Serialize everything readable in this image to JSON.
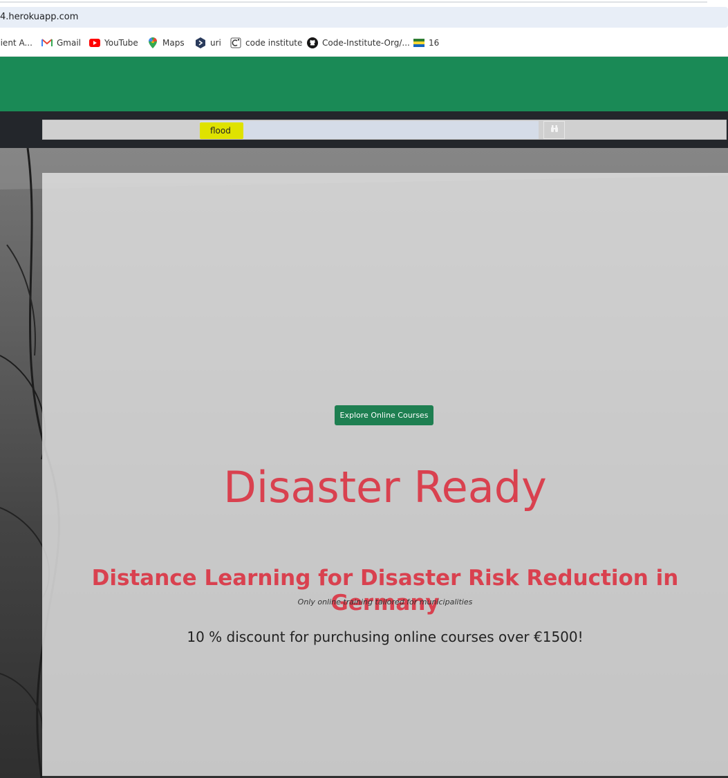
{
  "browser": {
    "url": "4.herokuapp.com",
    "bookmarks": [
      {
        "label": "cient A...",
        "icon": "bookmark-icon"
      },
      {
        "label": "Gmail",
        "icon": "gmail-icon"
      },
      {
        "label": "YouTube",
        "icon": "youtube-icon"
      },
      {
        "label": "Maps",
        "icon": "maps-pin-icon"
      },
      {
        "label": "uri",
        "icon": "uri-icon"
      },
      {
        "label": "code institute",
        "icon": "code-institute-icon"
      },
      {
        "label": "Code-Institute-Org/...",
        "icon": "github-icon"
      },
      {
        "label": "16",
        "icon": "flag-icon"
      }
    ]
  },
  "search": {
    "value": "flood",
    "button_icon": "binoculars-icon"
  },
  "hero": {
    "explore_button": "Explore Online Courses",
    "title": "Disaster Ready",
    "subtitle": "Distance Learning for Disaster Risk Reduction in Germany",
    "tagline": "Only online training tailored for municipalities",
    "offer": "10 % discount for purchusing online courses over €1500!"
  },
  "colors": {
    "header_green": "#1a8a56",
    "nav_dark": "#23262b",
    "button_green": "#1e7f51",
    "title_red": "#d9414f",
    "search_highlight": "#dfe200"
  }
}
